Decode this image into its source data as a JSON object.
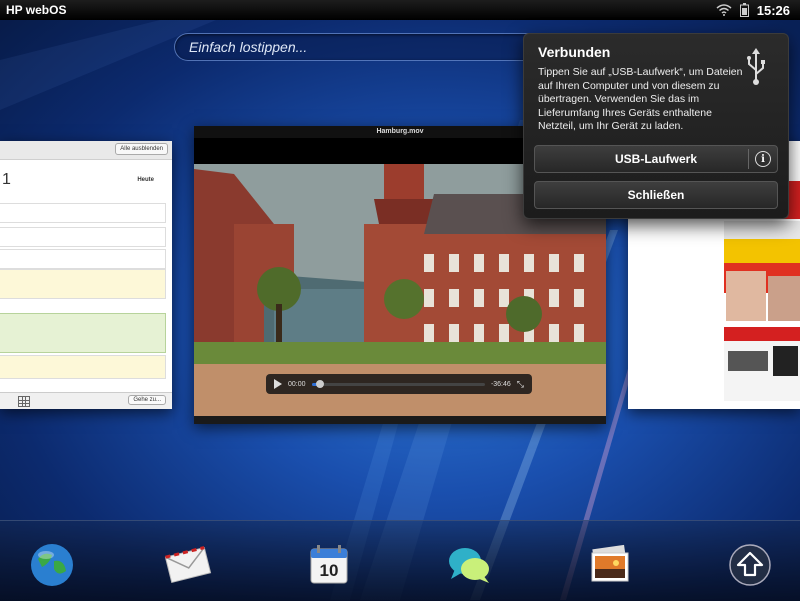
{
  "status_bar": {
    "brand": "HP webOS",
    "time": "15:26",
    "icons": [
      "wifi-icon",
      "battery-icon"
    ]
  },
  "search": {
    "placeholder": "Einfach lostippen..."
  },
  "cards": {
    "calendar": {
      "hide_all_label": "Alle ausblenden",
      "day_number": "1",
      "today_label": "Heute",
      "goto_label": "Gehe zu..."
    },
    "video": {
      "title": "Hamburg.mov",
      "time_elapsed": "00:00",
      "time_remaining": "-36:46",
      "progress": 0.05
    }
  },
  "notification": {
    "title": "Verbunden",
    "message": "Tippen Sie auf „USB-Laufwerk“, um Dateien auf Ihren Computer und von diesem zu übertragen. Verwenden Sie das im Lieferumfang Ihres Geräts enthaltene Netzteil, um Ihr Gerät zu laden.",
    "usb_button": "USB-Laufwerk",
    "close_button": "Schließen",
    "icon": "usb-icon"
  },
  "dock": {
    "items": [
      "browser-globe-icon",
      "email-envelope-icon",
      "calendar-icon",
      "messaging-icon",
      "photos-icon",
      "launcher-arrow-icon"
    ],
    "calendar_day": "10"
  },
  "colors": {
    "accent_blue": "#2f6fd6",
    "notification_bg": "#222222"
  }
}
